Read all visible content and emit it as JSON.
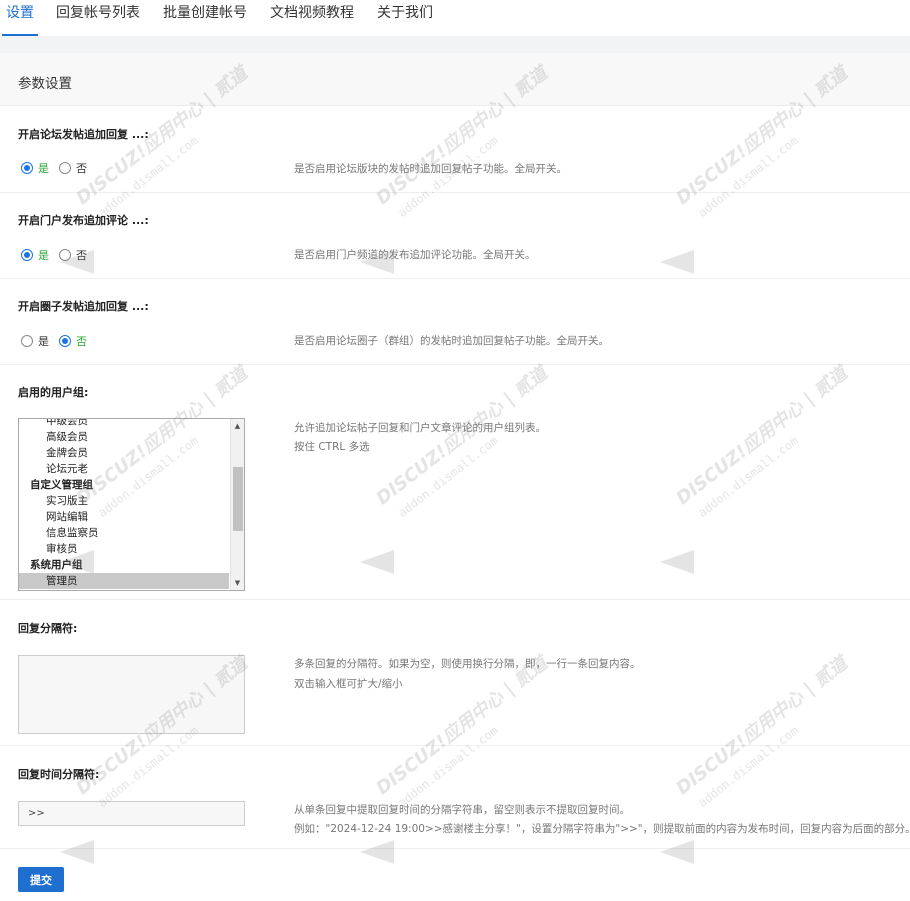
{
  "tabs": [
    {
      "label": "设置",
      "active": true
    },
    {
      "label": "回复帐号列表"
    },
    {
      "label": "批量创建帐号"
    },
    {
      "label": "文档视频教程"
    },
    {
      "label": "关于我们"
    }
  ],
  "section_title": "参数设置",
  "settings": [
    {
      "label": "开启论坛发帖追加回复 ...:",
      "options": [
        "是",
        "否"
      ],
      "selected": "是",
      "description": "是否启用论坛版块的发帖时追加回复帖子功能。全局开关。"
    },
    {
      "label": "开启门户发布追加评论 ...:",
      "options": [
        "是",
        "否"
      ],
      "selected": "是",
      "description": "是否启用门户频道的发布追加评论功能。全局开关。"
    },
    {
      "label": "开启圈子发帖追加回复 ...:",
      "options": [
        "是",
        "否"
      ],
      "selected": "否",
      "description": "是否启用论坛圈子（群组）的发帖时追加回复帖子功能。全局开关。"
    }
  ],
  "usergroups": {
    "label": "启用的用户组:",
    "description": [
      "允许追加论坛帖子回复和门户文章评论的用户组列表。",
      "按住 CTRL 多选"
    ],
    "options": [
      {
        "text": "中级会员",
        "group": false
      },
      {
        "text": "高级会员",
        "group": false
      },
      {
        "text": "金牌会员",
        "group": false
      },
      {
        "text": "论坛元老",
        "group": false
      },
      {
        "text": "自定义管理组",
        "group": true
      },
      {
        "text": "实习版主",
        "group": false
      },
      {
        "text": "网站编辑",
        "group": false
      },
      {
        "text": "信息监察员",
        "group": false
      },
      {
        "text": "审核员",
        "group": false
      },
      {
        "text": "系统用户组",
        "group": true
      },
      {
        "text": "管理员",
        "group": false,
        "selected": true
      }
    ]
  },
  "separator": {
    "label": "回复分隔符:",
    "value": "",
    "description": [
      "多条回复的分隔符。如果为空，则使用换行分隔，即，一行一条回复内容。",
      "双击输入框可扩大/缩小"
    ]
  },
  "time_separator": {
    "label": "回复时间分隔符:",
    "value": ">>",
    "description": [
      "从单条回复中提取回复时间的分隔字符串，留空则表示不提取回复时间。",
      "例如：\"2024-12-24 19:00>>感谢楼主分享！\"，设置分隔字符串为\">>\"，则提取前面的内容为发布时间，回复内容为后面的部分。"
    ]
  },
  "submit_label": "提交",
  "watermark": {
    "brand": "DISCUZ!应用中心 | 贰道",
    "domain": "addon.dismall.com"
  },
  "colors": {
    "accent": "#1e6fd0",
    "on": "#2aa632"
  }
}
